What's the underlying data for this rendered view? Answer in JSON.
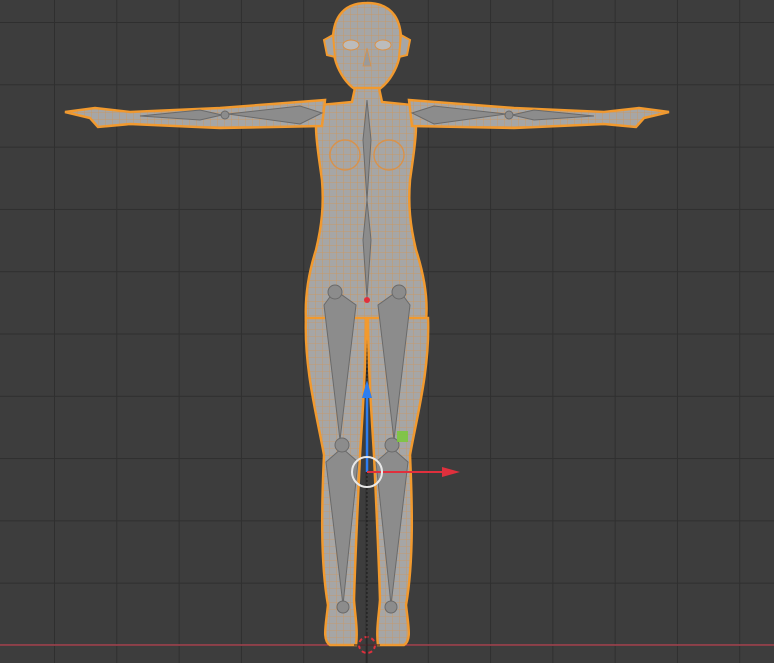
{
  "viewport": {
    "background_color": "#3d3d3d",
    "grid_color": "#2f2f2f",
    "x_axis_color": "#a6434f",
    "z_axis_color": "#5b7fbf"
  },
  "object": {
    "mesh_fill_color": "#a6a6a6",
    "wire_color": "#d9924a",
    "outline_color": "#f29a2e",
    "bone_color": "#8c8c8c",
    "selected_state": "selected"
  },
  "gizmo": {
    "x_arrow_color": "#e0303d",
    "z_arrow_color": "#2d7ef0",
    "origin_circle_color": "#e8e8e8",
    "handle_color": "#79c93a"
  },
  "icons": {
    "move_gizmo": "transform-arrows-icon",
    "origin": "object-origin-icon",
    "cursor": "3d-cursor-icon"
  }
}
